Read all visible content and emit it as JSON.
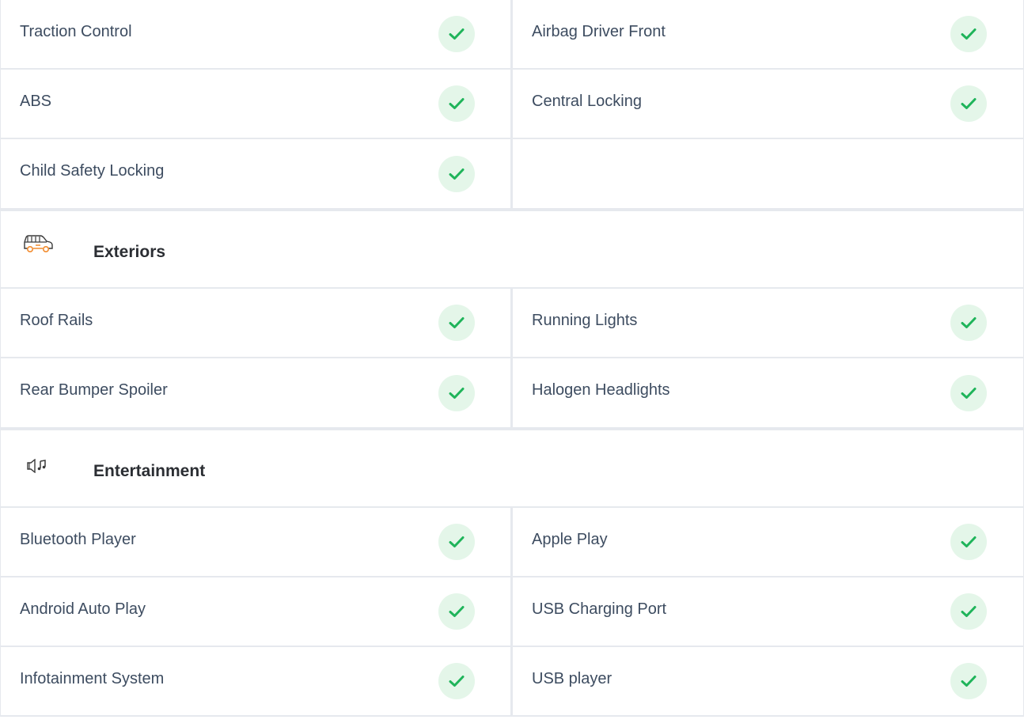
{
  "colors": {
    "check_bg": "#e4f6e9",
    "check_mark": "#1fb45a",
    "icon_orange": "#f28b2d",
    "divider": "#e6e9ee"
  },
  "safety": {
    "rows": [
      {
        "left": "Traction Control",
        "right": "Airbag Driver Front"
      },
      {
        "left": "ABS",
        "right": "Central Locking"
      },
      {
        "left": "Child Safety Locking",
        "right": ""
      }
    ]
  },
  "exteriors": {
    "title": "Exteriors",
    "icon": "car-icon",
    "rows": [
      {
        "left": "Roof Rails",
        "right": "Running Lights"
      },
      {
        "left": "Rear Bumper Spoiler",
        "right": "Halogen Headlights"
      }
    ]
  },
  "entertainment": {
    "title": "Entertainment",
    "icon": "speaker-music-icon",
    "rows": [
      {
        "left": "Bluetooth Player",
        "right": "Apple Play"
      },
      {
        "left": "Android Auto Play",
        "right": "USB Charging Port"
      },
      {
        "left": "Infotainment System",
        "right": "USB player"
      }
    ]
  }
}
